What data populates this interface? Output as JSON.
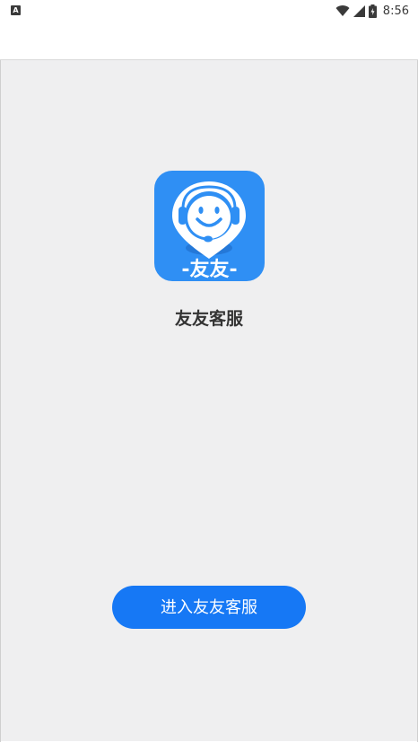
{
  "status_bar": {
    "notification_icon": "A",
    "time": "8:56",
    "icons": [
      "wifi-icon",
      "signal-icon",
      "battery-icon"
    ]
  },
  "app": {
    "icon_text": "-友友-",
    "name": "友友客服",
    "brand_color": "#2f8ff4"
  },
  "button": {
    "label": "进入友友客服",
    "color": "#1678f5"
  },
  "colors": {
    "background": "#efeff0"
  }
}
